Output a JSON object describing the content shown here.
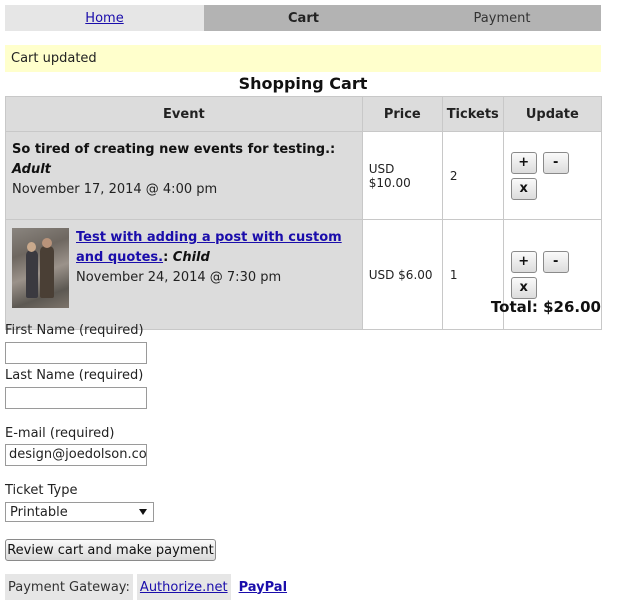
{
  "steps": {
    "home": "Home",
    "cart": "Cart",
    "payment": "Payment"
  },
  "notice": "Cart updated",
  "cart": {
    "title": "Shopping Cart",
    "headers": {
      "event": "Event",
      "price": "Price",
      "tickets": "Tickets",
      "update": "Update"
    },
    "rows": [
      {
        "title": "So tired of creating new events for testing.",
        "separator": ": ",
        "ticket_type": "Adult",
        "date": "November 17, 2014 @ 4:00 pm",
        "price": "USD $10.00",
        "tickets": "2"
      },
      {
        "title": "Test with adding a post with custom and quotes.",
        "separator": ": ",
        "ticket_type": "Child",
        "date": "November 24, 2014 @ 7:30 pm",
        "price": "USD $6.00",
        "tickets": "1"
      }
    ],
    "buttons": {
      "plus": "+",
      "minus": "-",
      "remove": "x"
    },
    "total": "Total: $26.00"
  },
  "form": {
    "first_name_label": "First Name (required)",
    "first_name_value": "",
    "last_name_label": "Last Name (required)",
    "last_name_value": "",
    "email_label": "E-mail (required)",
    "email_value": "design@joedolson.com",
    "ticket_type_label": "Ticket Type",
    "ticket_type_value": "Printable",
    "review_button": "Review cart and make payment"
  },
  "gateway": {
    "label": "Payment Gateway:",
    "authorize": "Authorize.net",
    "paypal": "PayPal"
  },
  "colors": {
    "link": "#1a0dab",
    "notice_bg": "#ffffcc",
    "active_step": "#b3b3b3"
  }
}
